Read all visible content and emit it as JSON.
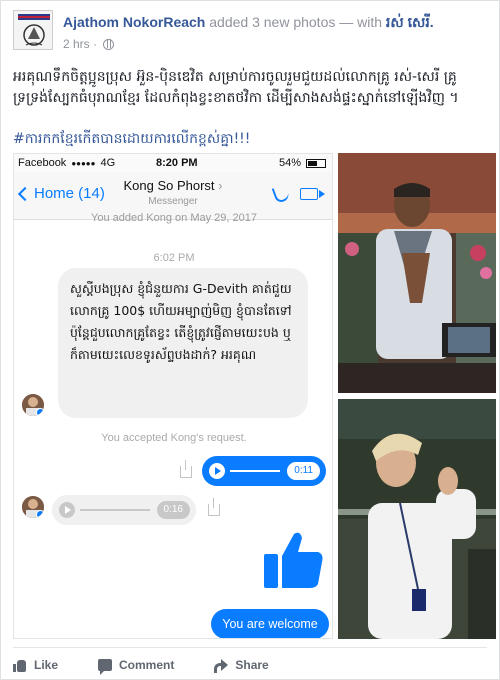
{
  "post": {
    "author": "Ajathom NokorReach",
    "action_text": " added 3 new photos — with ",
    "tagged": "រស់ សេរី.",
    "time": "2 hrs · ",
    "privacy_icon": "globe-icon",
    "caption": "អរគុណទឹកចិត្តប្អូនប្រុស អ៊ួន-ប៉ិនឌេវិត សម្រាប់ការចូលរួមជួយដល់លោកគ្រូ រស់-សេរី គ្រូទ្រទ្រង់ស្បែកធំបុរាណខ្មែរ ដែលកំពុងខ្វះខាតថវិកា ដើម្បីសាងសង់ផ្ទះស្នាក់នៅឡើងវិញ ។",
    "hashtag": "#ការកកខ្មែរកើតបានដោយការលើកខ្ពស់គ្នា!!!"
  },
  "phone": {
    "status": {
      "carrier": "Facebook",
      "signal": "●●●●●",
      "network": "4G",
      "time": "8:20 PM",
      "battery": "54%"
    },
    "nav": {
      "back_label": "Home (14)",
      "contact_name": "Kong So Phorst",
      "contact_sub": "Messenger"
    },
    "system_added": "You added Kong on May 29, 2017",
    "system_time": "6:02 PM",
    "incoming_message": "សួស្តីបងប្រុស ខ្ញុំជំនួយការ G-Devith គាត់ជួយលោកគ្រូ 100$ ហើយអម្បាញ់មិញ ខ្ញុំបានតែទៅប៉ុន្តែជួបលោកគ្រូតែខ្វះ តើខ្ញុំត្រូវផ្ញើតាមយេះបង ឬក៏តាមយេះលេខទូរស័ព្ទបងដាក់? អរគុណ",
    "system_accepted": "You accepted Kong's request.",
    "audio_out_time": "0:11",
    "audio_in_time": "0:16",
    "outgoing_message": "You are welcome"
  },
  "actions": {
    "like": "Like",
    "comment": "Comment",
    "share": "Share"
  },
  "colors": {
    "facebook_link": "#365899",
    "messenger_blue": "#0a7cff"
  }
}
